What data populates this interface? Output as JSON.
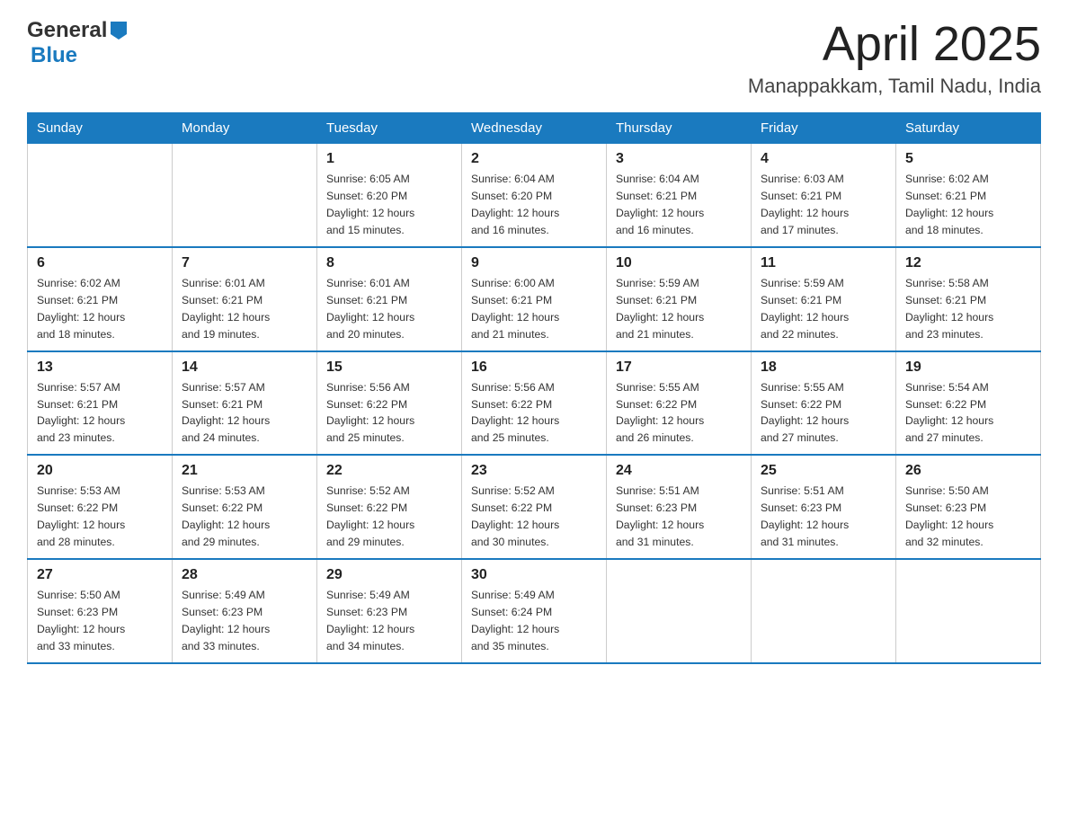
{
  "header": {
    "logo": {
      "general": "General",
      "blue": "Blue"
    },
    "month": "April 2025",
    "location": "Manappakkam, Tamil Nadu, India"
  },
  "weekdays": [
    "Sunday",
    "Monday",
    "Tuesday",
    "Wednesday",
    "Thursday",
    "Friday",
    "Saturday"
  ],
  "weeks": [
    [
      {
        "day": "",
        "info": ""
      },
      {
        "day": "",
        "info": ""
      },
      {
        "day": "1",
        "info": "Sunrise: 6:05 AM\nSunset: 6:20 PM\nDaylight: 12 hours\nand 15 minutes."
      },
      {
        "day": "2",
        "info": "Sunrise: 6:04 AM\nSunset: 6:20 PM\nDaylight: 12 hours\nand 16 minutes."
      },
      {
        "day": "3",
        "info": "Sunrise: 6:04 AM\nSunset: 6:21 PM\nDaylight: 12 hours\nand 16 minutes."
      },
      {
        "day": "4",
        "info": "Sunrise: 6:03 AM\nSunset: 6:21 PM\nDaylight: 12 hours\nand 17 minutes."
      },
      {
        "day": "5",
        "info": "Sunrise: 6:02 AM\nSunset: 6:21 PM\nDaylight: 12 hours\nand 18 minutes."
      }
    ],
    [
      {
        "day": "6",
        "info": "Sunrise: 6:02 AM\nSunset: 6:21 PM\nDaylight: 12 hours\nand 18 minutes."
      },
      {
        "day": "7",
        "info": "Sunrise: 6:01 AM\nSunset: 6:21 PM\nDaylight: 12 hours\nand 19 minutes."
      },
      {
        "day": "8",
        "info": "Sunrise: 6:01 AM\nSunset: 6:21 PM\nDaylight: 12 hours\nand 20 minutes."
      },
      {
        "day": "9",
        "info": "Sunrise: 6:00 AM\nSunset: 6:21 PM\nDaylight: 12 hours\nand 21 minutes."
      },
      {
        "day": "10",
        "info": "Sunrise: 5:59 AM\nSunset: 6:21 PM\nDaylight: 12 hours\nand 21 minutes."
      },
      {
        "day": "11",
        "info": "Sunrise: 5:59 AM\nSunset: 6:21 PM\nDaylight: 12 hours\nand 22 minutes."
      },
      {
        "day": "12",
        "info": "Sunrise: 5:58 AM\nSunset: 6:21 PM\nDaylight: 12 hours\nand 23 minutes."
      }
    ],
    [
      {
        "day": "13",
        "info": "Sunrise: 5:57 AM\nSunset: 6:21 PM\nDaylight: 12 hours\nand 23 minutes."
      },
      {
        "day": "14",
        "info": "Sunrise: 5:57 AM\nSunset: 6:21 PM\nDaylight: 12 hours\nand 24 minutes."
      },
      {
        "day": "15",
        "info": "Sunrise: 5:56 AM\nSunset: 6:22 PM\nDaylight: 12 hours\nand 25 minutes."
      },
      {
        "day": "16",
        "info": "Sunrise: 5:56 AM\nSunset: 6:22 PM\nDaylight: 12 hours\nand 25 minutes."
      },
      {
        "day": "17",
        "info": "Sunrise: 5:55 AM\nSunset: 6:22 PM\nDaylight: 12 hours\nand 26 minutes."
      },
      {
        "day": "18",
        "info": "Sunrise: 5:55 AM\nSunset: 6:22 PM\nDaylight: 12 hours\nand 27 minutes."
      },
      {
        "day": "19",
        "info": "Sunrise: 5:54 AM\nSunset: 6:22 PM\nDaylight: 12 hours\nand 27 minutes."
      }
    ],
    [
      {
        "day": "20",
        "info": "Sunrise: 5:53 AM\nSunset: 6:22 PM\nDaylight: 12 hours\nand 28 minutes."
      },
      {
        "day": "21",
        "info": "Sunrise: 5:53 AM\nSunset: 6:22 PM\nDaylight: 12 hours\nand 29 minutes."
      },
      {
        "day": "22",
        "info": "Sunrise: 5:52 AM\nSunset: 6:22 PM\nDaylight: 12 hours\nand 29 minutes."
      },
      {
        "day": "23",
        "info": "Sunrise: 5:52 AM\nSunset: 6:22 PM\nDaylight: 12 hours\nand 30 minutes."
      },
      {
        "day": "24",
        "info": "Sunrise: 5:51 AM\nSunset: 6:23 PM\nDaylight: 12 hours\nand 31 minutes."
      },
      {
        "day": "25",
        "info": "Sunrise: 5:51 AM\nSunset: 6:23 PM\nDaylight: 12 hours\nand 31 minutes."
      },
      {
        "day": "26",
        "info": "Sunrise: 5:50 AM\nSunset: 6:23 PM\nDaylight: 12 hours\nand 32 minutes."
      }
    ],
    [
      {
        "day": "27",
        "info": "Sunrise: 5:50 AM\nSunset: 6:23 PM\nDaylight: 12 hours\nand 33 minutes."
      },
      {
        "day": "28",
        "info": "Sunrise: 5:49 AM\nSunset: 6:23 PM\nDaylight: 12 hours\nand 33 minutes."
      },
      {
        "day": "29",
        "info": "Sunrise: 5:49 AM\nSunset: 6:23 PM\nDaylight: 12 hours\nand 34 minutes."
      },
      {
        "day": "30",
        "info": "Sunrise: 5:49 AM\nSunset: 6:24 PM\nDaylight: 12 hours\nand 35 minutes."
      },
      {
        "day": "",
        "info": ""
      },
      {
        "day": "",
        "info": ""
      },
      {
        "day": "",
        "info": ""
      }
    ]
  ]
}
